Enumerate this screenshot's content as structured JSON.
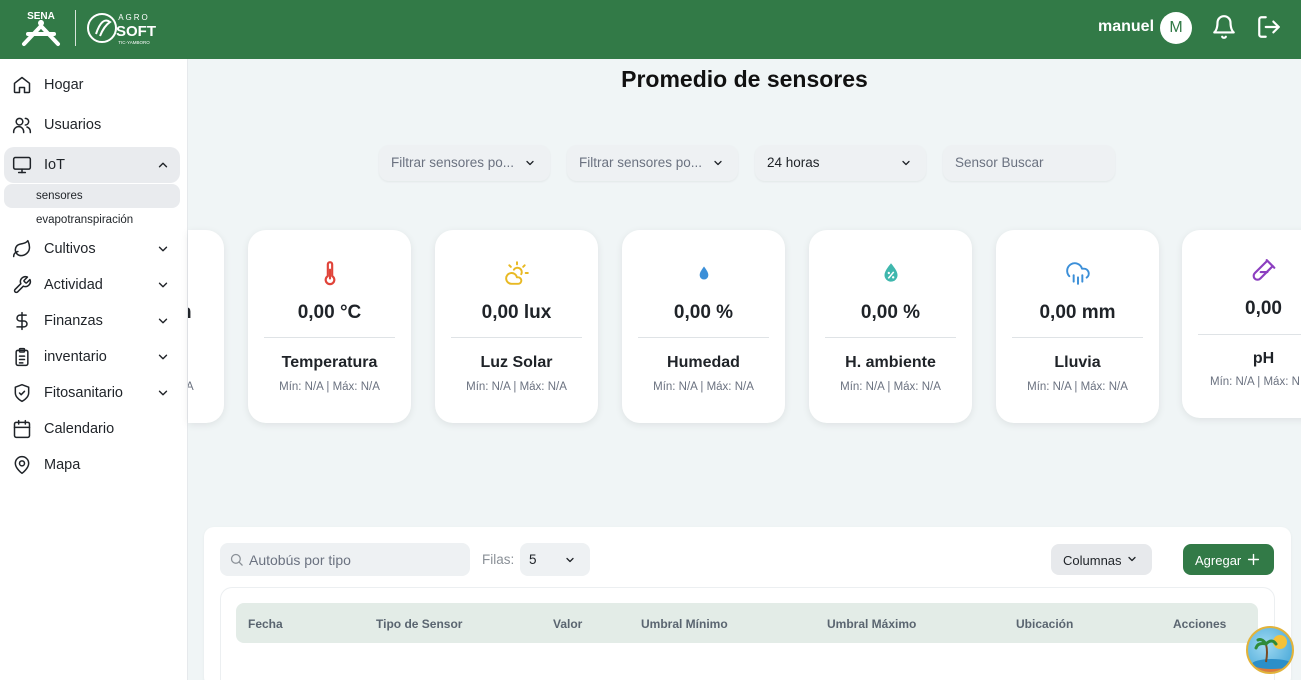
{
  "header": {
    "brand_sena": "SENA",
    "brand_agro": "AGRO",
    "brand_soft": "SOFT",
    "brand_sub": "TIC-YAMBORO",
    "user_name": "manuel",
    "avatar_initial": "M",
    "bg_color": "#327a47"
  },
  "sidebar": {
    "items": [
      {
        "label": "Hogar",
        "icon": "home-icon"
      },
      {
        "label": "Usuarios",
        "icon": "users-icon"
      },
      {
        "label": "IoT",
        "icon": "monitor-icon",
        "expanded": true
      },
      {
        "label": "Cultivos",
        "icon": "leaf-icon"
      },
      {
        "label": "Actividad",
        "icon": "wrench-icon"
      },
      {
        "label": "Finanzas",
        "icon": "dollar-icon"
      },
      {
        "label": "inventario",
        "icon": "clipboard-icon"
      },
      {
        "label": "Fitosanitario",
        "icon": "shield-check-icon"
      },
      {
        "label": "Calendario",
        "icon": "calendar-icon"
      },
      {
        "label": "Mapa",
        "icon": "map-pin-icon"
      }
    ],
    "iot_sub": [
      {
        "label": "sensores",
        "active": true
      },
      {
        "label": "evapotranspiración",
        "active": false
      }
    ]
  },
  "main": {
    "title": "Promedio de sensores",
    "filters": {
      "sensor_filter_1": "Filtrar sensores po...",
      "sensor_filter_2": "Filtrar sensores po...",
      "time_range": "24 horas",
      "search_placeholder": "Sensor Buscar"
    },
    "cards": [
      {
        "value": "0,00 °C",
        "name": "Temperatura",
        "minmax": "Mín: N/A | Máx: N/A",
        "icon": "thermometer-icon",
        "color": "#e0443a"
      },
      {
        "value": "0,00 lux",
        "name": "Luz Solar",
        "minmax": "Mín: N/A | Máx: N/A",
        "icon": "sun-cloud-icon",
        "color": "#e8b923"
      },
      {
        "value": "0,00 %",
        "name": "Humedad",
        "minmax": "Mín: N/A | Máx: N/A",
        "icon": "droplet-icon",
        "color": "#3b8fd8"
      },
      {
        "value": "0,00 %",
        "name": "H. ambiente",
        "minmax": "Mín: N/A | Máx: N/A",
        "icon": "droplet-percent-icon",
        "color": "#3fb7ad"
      },
      {
        "value": "0,00 mm",
        "name": "Lluvia",
        "minmax": "Mín: N/A | Máx: N/A",
        "icon": "cloud-rain-icon",
        "color": "#3b8fd8"
      },
      {
        "value": "0,00",
        "name": "pH",
        "minmax": "Mín: N/A | Máx: N",
        "icon": "test-tube-icon",
        "color": "#8c3fc0"
      }
    ],
    "partial_card": {
      "value_tail": "n",
      "minmax_tail": "A"
    }
  },
  "table": {
    "search_placeholder": "Autobús por tipo",
    "rows_label": "Filas:",
    "rows_value": "5",
    "columns_button": "Columnas",
    "add_button": "Agregar",
    "headers": [
      "Fecha",
      "Tipo de Sensor",
      "Valor",
      "Umbral Mínimo",
      "Umbral Máximo",
      "Ubicación",
      "Acciones"
    ]
  }
}
